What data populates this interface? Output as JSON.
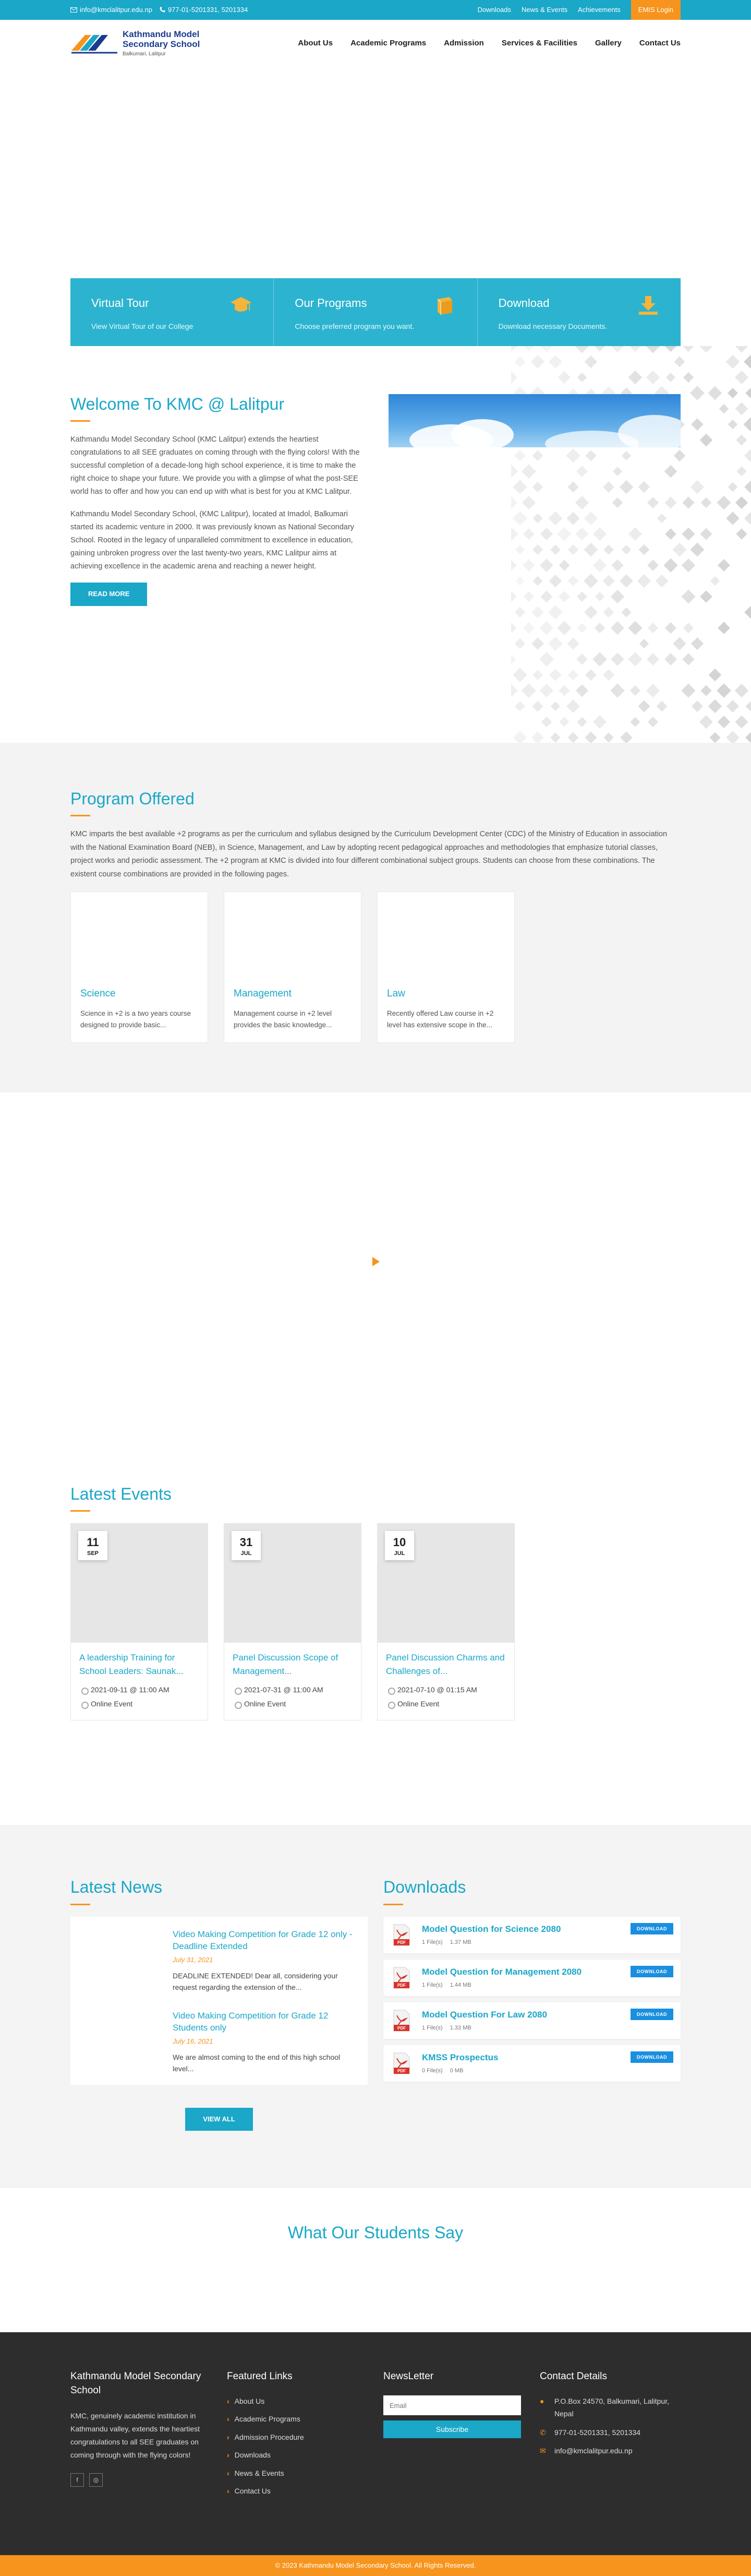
{
  "topbar": {
    "email": "info@kmclalitpur.edu.np",
    "phone": "977-01-5201331, 5201334",
    "links": [
      "Downloads",
      "News & Events",
      "Achievements"
    ],
    "login": "EMIS Login"
  },
  "header": {
    "logo_line1": "Kathmandu Model",
    "logo_line2": "Secondary School",
    "logo_line3": "Balkumari, Lalitpur",
    "nav": [
      "About Us",
      "Academic Programs",
      "Admission",
      "Services & Facilities",
      "Gallery",
      "Contact Us"
    ]
  },
  "features": [
    {
      "title": "Virtual Tour",
      "text": "View Virtual Tour of our College",
      "icon": "graduation-cap-icon"
    },
    {
      "title": "Our Programs",
      "text": "Choose preferred program you want.",
      "icon": "book-icon"
    },
    {
      "title": "Download",
      "text": "Download necessary Documents.",
      "icon": "download-icon"
    }
  ],
  "welcome": {
    "title": "Welcome To KMC @ Lalitpur",
    "p1": "Kathmandu Model Secondary School (KMC Lalitpur) extends the heartiest congratulations to all SEE graduates on coming through with the flying colors! With the successful completion of a decade-long high school experience, it is time to make the right choice to shape your future. We provide you with a glimpse of what the post-SEE world has to offer and how you can end up with what is best for you at KMC Lalitpur.",
    "p2": "Kathmandu Model Secondary School, (KMC Lalitpur), located at Imadol, Balkumari started its academic venture in 2000. It was previously known as National Secondary School. Rooted in the legacy of unparalleled commitment to excellence in education, gaining unbroken progress over the last twenty-two years, KMC Lalitpur aims at achieving excellence in the academic arena and reaching a newer height.",
    "button": "READ MORE"
  },
  "program": {
    "title": "Program Offered",
    "desc": "KMC imparts the best available +2 programs as per the curriculum and syllabus designed by the Curriculum Development Center (CDC) of the Ministry of Education in association with the National Examination Board (NEB), in Science, Management, and Law by adopting recent pedagogical approaches and methodologies that emphasize tutorial classes, project works and periodic assessment. The +2 program at KMC is divided into four different combinational subject groups. Students can choose from these combinations. The existent course combinations are provided in the following pages.",
    "cards": [
      {
        "title": "Science",
        "text": "Science in +2 is a two years course designed to provide basic..."
      },
      {
        "title": "Management",
        "text": "Management course in +2 level provides the basic knowledge..."
      },
      {
        "title": "Law",
        "text": "Recently offered Law course in +2 level has extensive scope in the..."
      }
    ]
  },
  "events": {
    "title": "Latest Events",
    "items": [
      {
        "day": "11",
        "month": "SEP",
        "title": "A leadership Training for School Leaders: Saunak...",
        "time": "2021-09-11 @ 11:00 AM",
        "place": "Online Event"
      },
      {
        "day": "31",
        "month": "JUL",
        "title": "Panel Discussion Scope of Management...",
        "time": "2021-07-31 @ 11:00 AM",
        "place": "Online Event"
      },
      {
        "day": "10",
        "month": "JUL",
        "title": "Panel Discussion Charms and Challenges of...",
        "time": "2021-07-10 @ 01:15 AM",
        "place": "Online Event"
      }
    ]
  },
  "news": {
    "title": "Latest News",
    "items": [
      {
        "title": "Video Making Competition for Grade 12 only - Deadline Extended",
        "date": "July 31, 2021",
        "text": "DEADLINE EXTENDED! Dear all, considering your request regarding the extension of the..."
      },
      {
        "title": "Video Making Competition for Grade 12 Students only",
        "date": "July 16, 2021",
        "text": "We are almost coming to the end of this high school level..."
      }
    ],
    "button": "VIEW ALL"
  },
  "downloads": {
    "title": "Downloads",
    "button": "DOWNLOAD",
    "items": [
      {
        "title": "Model Question for Science 2080",
        "files": "1 File(s)",
        "size": "1.37 MB"
      },
      {
        "title": "Model Question for Management 2080",
        "files": "1 File(s)",
        "size": "1.44 MB"
      },
      {
        "title": "Model Question For Law 2080",
        "files": "1 File(s)",
        "size": "1.33 MB"
      },
      {
        "title": "KMSS Prospectus",
        "files": "0 File(s)",
        "size": "0 MB"
      }
    ]
  },
  "testimonials": {
    "title": "What Our Students Say"
  },
  "footer": {
    "about_title": "Kathmandu Model Secondary School",
    "about_text": "KMC, genuinely academic institution in Kathmandu valley, extends the heartiest congratulations to all SEE graduates on coming through with the flying colors!",
    "links_title": "Featured Links",
    "links": [
      "About Us",
      "Academic Programs",
      "Admission Procedure",
      "Downloads",
      "News & Events",
      "Contact Us"
    ],
    "newsletter_title": "NewsLetter",
    "newsletter_placeholder": "Email",
    "subscribe": "Subscribe",
    "contact_title": "Contact Details",
    "address": "P.O.Box 24570, Balkumari, Lalitpur, Nepal",
    "phone": "977-01-5201331, 5201334",
    "email": "info@kmclalitpur.edu.np",
    "copyright": "© 2023 Kathmandu Model Secondary School. All Rights Reserved."
  },
  "colors": {
    "primary": "#1aa7c8",
    "accent": "#f7941d",
    "dark": "#2d2d2d"
  }
}
